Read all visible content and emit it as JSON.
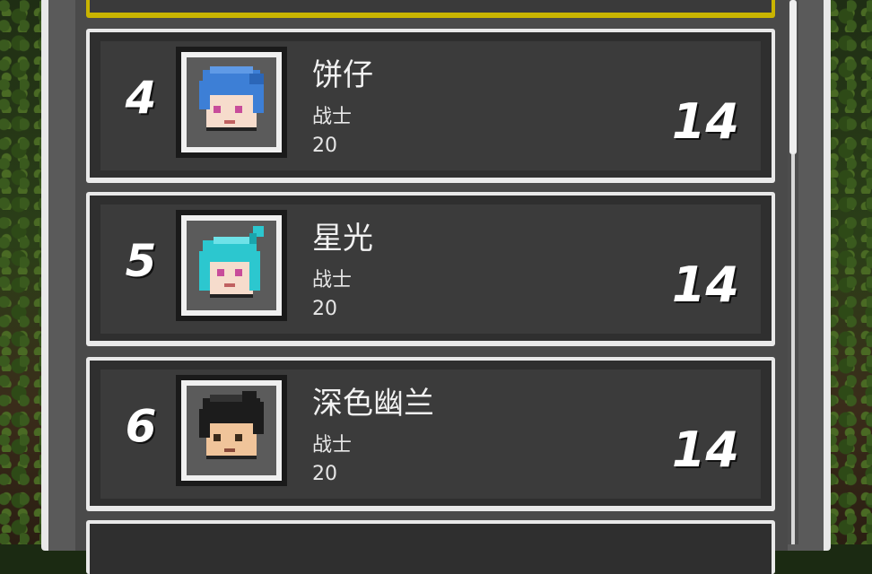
{
  "leaderboard": {
    "entries": [
      {
        "rank": "4",
        "name": "饼仔",
        "class": "战士",
        "level": "20",
        "score": "14",
        "avatar": "blue-hair-character-icon",
        "hair_color": "#3d7fd6"
      },
      {
        "rank": "5",
        "name": "星光",
        "class": "战士",
        "level": "20",
        "score": "14",
        "avatar": "cyan-hair-character-icon",
        "hair_color": "#2cc7cf"
      },
      {
        "rank": "6",
        "name": "深色幽兰",
        "class": "战士",
        "level": "20",
        "score": "14",
        "avatar": "black-hair-character-icon",
        "hair_color": "#1c1c1c"
      }
    ]
  },
  "colors": {
    "highlight_border": "#c9b400",
    "row_border": "#e9e9e9",
    "row_bg": "#3b3b3b"
  }
}
